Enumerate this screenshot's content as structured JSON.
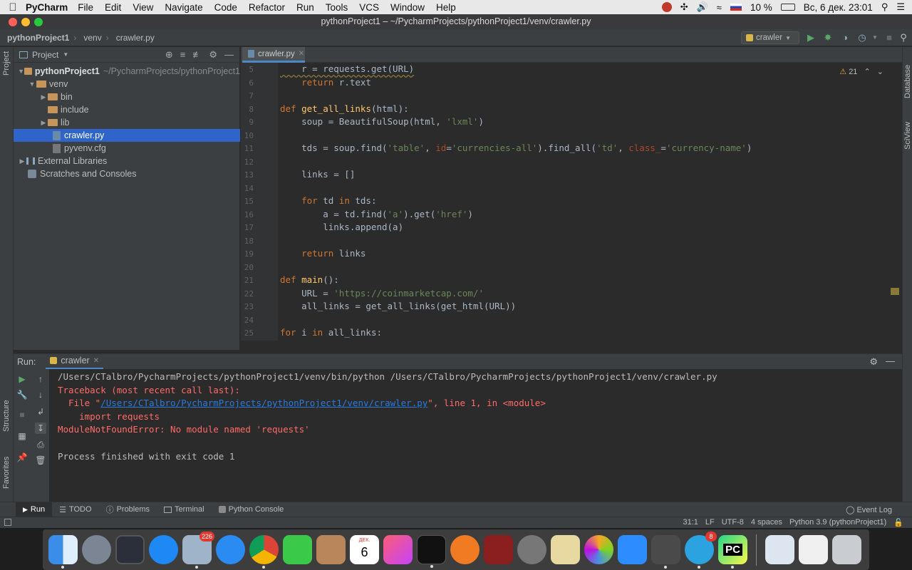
{
  "menubar": {
    "app_name": "PyCharm",
    "items": [
      "File",
      "Edit",
      "View",
      "Navigate",
      "Code",
      "Refactor",
      "Run",
      "Tools",
      "VCS",
      "Window",
      "Help"
    ],
    "battery": "10 %",
    "datetime": "Вс, 6 дек.  23:01"
  },
  "window": {
    "title": "pythonProject1 – ~/PycharmProjects/pythonProject1/venv/crawler.py"
  },
  "navbar": {
    "crumbs": [
      "pythonProject1",
      "venv",
      "crawler.py"
    ],
    "run_config": "crawler"
  },
  "side_tabs": {
    "project": "Project",
    "structure": "Structure",
    "favorites": "Favorites",
    "database": "Database",
    "sciview": "SciView"
  },
  "project_panel": {
    "header": "Project",
    "tree": [
      {
        "label": "pythonProject1",
        "suffix": "~/PycharmProjects/pythonProject1",
        "bold": true
      },
      {
        "label": "venv"
      },
      {
        "label": "bin"
      },
      {
        "label": "include"
      },
      {
        "label": "lib"
      },
      {
        "label": "crawler.py"
      },
      {
        "label": "pyvenv.cfg"
      },
      {
        "label": "External Libraries"
      },
      {
        "label": "Scratches and Consoles"
      }
    ]
  },
  "editor": {
    "tab_label": "crawler.py",
    "warnings_count": "21",
    "line_numbers": [
      "5",
      "6",
      "7",
      "8",
      "9",
      "10",
      "11",
      "12",
      "13",
      "14",
      "15",
      "16",
      "17",
      "18",
      "19",
      "20",
      "21",
      "22",
      "23",
      "24",
      "25"
    ],
    "code_fragments": {
      "l5": "    r = requests.get(URL)",
      "l6_kw": "    return",
      "l6": " r.text",
      "l8_kw": "def ",
      "l8_fn": "get_all_links",
      "l8": "(html):",
      "l9a": "    soup = BeautifulSoup(html, ",
      "l9s": "'lxml'",
      "l9b": ")",
      "l11a": "    tds = soup.find(",
      "l11s1": "'table'",
      "l11b": ", ",
      "l11p1": "id",
      "l11c": "=",
      "l11s2": "'currencies-all'",
      "l11d": ").find_all(",
      "l11s3": "'td'",
      "l11e": ", ",
      "l11p2": "class_",
      "l11f": "=",
      "l11s4": "'currency-name'",
      "l11g": ")",
      "l13": "    links = []",
      "l15_kw1": "    for",
      "l15a": " td ",
      "l15_kw2": "in",
      "l15b": " tds:",
      "l16a": "        a = td.find(",
      "l16s1": "'a'",
      "l16b": ").get(",
      "l16s2": "'href'",
      "l16c": ")",
      "l17": "        links.append(a)",
      "l19_kw": "    return",
      "l19": " links",
      "l21_kw": "def ",
      "l21_fn": "main",
      "l21": "():",
      "l22a": "    URL = ",
      "l22s": "'https://coinmarketcap.com/'",
      "l23": "    all_links = get_all_links(get_html(URL))",
      "l25_kw1": "for",
      "l25a": " i ",
      "l25_kw2": "in",
      "l25b": " all_links:"
    }
  },
  "run_panel": {
    "label": "Run:",
    "tab": "crawler",
    "console": {
      "cmd": "/Users/CTalbro/PycharmProjects/pythonProject1/venv/bin/python /Users/CTalbro/PycharmProjects/pythonProject1/venv/crawler.py",
      "tb1": "Traceback (most recent call last):",
      "tb2a": "  File \"",
      "tb2link": "/Users/CTalbro/PycharmProjects/pythonProject1/venv/crawler.py",
      "tb2b": "\", line 1, in <module>",
      "tb3": "    import requests",
      "tb4": "ModuleNotFoundError: No module named 'requests'",
      "exit": "Process finished with exit code 1"
    }
  },
  "bottom_tools": {
    "run": "Run",
    "todo": "TODO",
    "problems": "Problems",
    "terminal": "Terminal",
    "python_console": "Python Console",
    "event_log": "Event Log"
  },
  "statusbar": {
    "position": "31:1",
    "line_sep": "LF",
    "encoding": "UTF-8",
    "indent": "4 spaces",
    "interpreter": "Python 3.9 (pythonProject1)"
  },
  "dock": {
    "mail_badge": "226",
    "calendar_month": "ДЕК.",
    "calendar_day": "6",
    "telegram_badge": "8",
    "pycharm_label": "PC"
  },
  "colors": {
    "accent": "#2f65ca",
    "keyword": "#cc7832",
    "function": "#ffc66d",
    "string": "#6a8759",
    "error": "#ff6b68",
    "link": "#287bde"
  }
}
